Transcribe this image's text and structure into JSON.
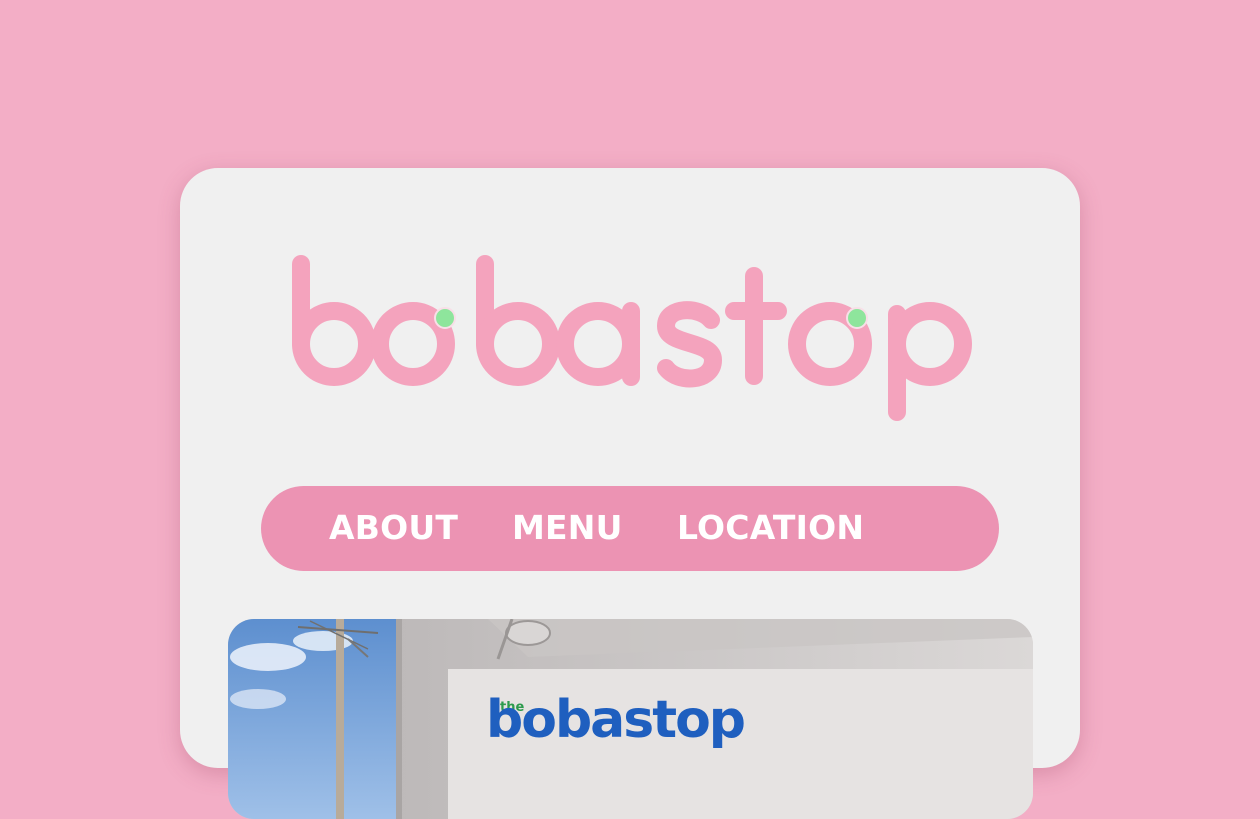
{
  "brand": {
    "name": "bobastop",
    "colors": {
      "page_background": "#f3aec6",
      "card_background": "#f0f0f0",
      "logo_pink": "#f4a3bd",
      "boba_dot": "#8ee59c",
      "nav_background": "#ec93b3",
      "nav_text": "#ffffff"
    }
  },
  "nav": {
    "items": [
      {
        "label": "ABOUT"
      },
      {
        "label": "MENU"
      },
      {
        "label": "LOCATION"
      }
    ]
  },
  "hero": {
    "sign_text_small": "the",
    "sign_text": "bobastop",
    "image_alt": "Storefront photo with the bobastop sign"
  }
}
